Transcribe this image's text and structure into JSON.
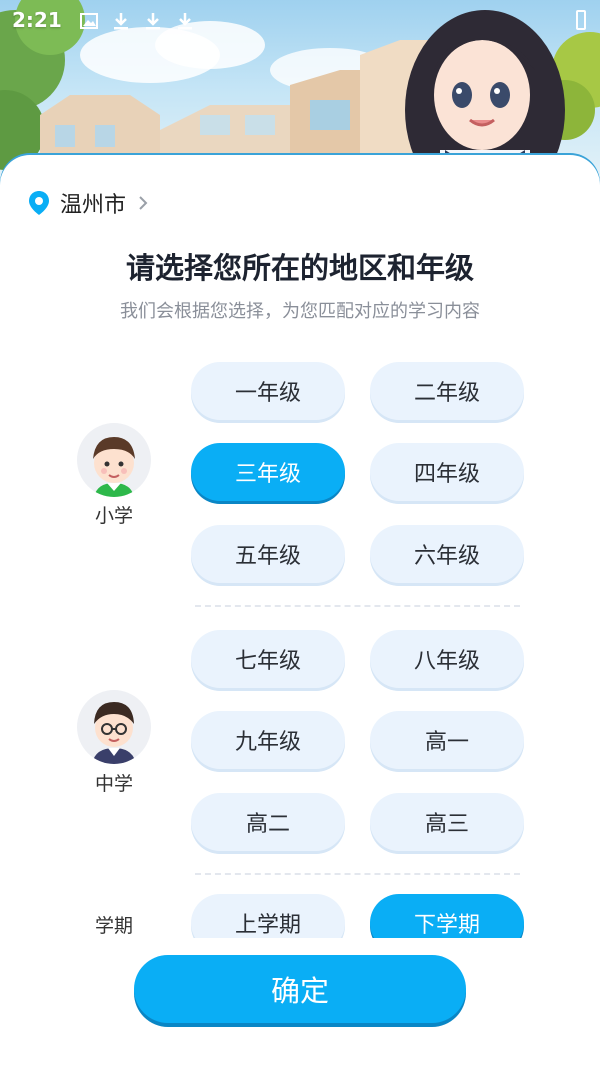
{
  "status_bar": {
    "time": "2:21"
  },
  "location": {
    "city": "温州市"
  },
  "heading": {
    "title": "请选择您所在的地区和年级",
    "subtitle": "我们会根据您选择，为您匹配对应的学习内容"
  },
  "primary": {
    "label": "小学",
    "grades": [
      "一年级",
      "二年级",
      "三年级",
      "四年级",
      "五年级",
      "六年级"
    ],
    "selected": "三年级"
  },
  "middle": {
    "label": "中学",
    "grades": [
      "七年级",
      "八年级",
      "九年级",
      "高一",
      "高二",
      "高三"
    ]
  },
  "semester": {
    "label": "学期",
    "options": [
      "上学期",
      "下学期"
    ],
    "selected": "下学期"
  },
  "confirm_label": "确定",
  "colors": {
    "accent": "#0aaef5",
    "button_bg": "#eaf3fd"
  }
}
